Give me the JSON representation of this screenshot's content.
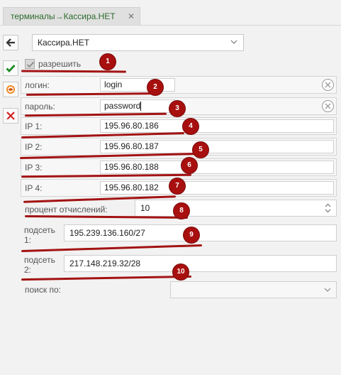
{
  "tab": {
    "title": "терминалы→Кассира.НЕТ",
    "close": "✕"
  },
  "toolbar": {
    "back_icon": "arrow-left-icon",
    "save_icon": "check-icon",
    "cancel_icon": "cancel-circle-icon",
    "delete_icon": "red-x-icon"
  },
  "select": {
    "value": "Кассира.НЕТ"
  },
  "enable": {
    "label": "разрешить",
    "checked": true
  },
  "login": {
    "label": "логин:",
    "value": "login"
  },
  "password": {
    "label": "пароль:",
    "value": "password"
  },
  "ip": [
    {
      "label": "IP 1:",
      "value": "195.96.80.186"
    },
    {
      "label": "IP 2:",
      "value": "195.96.80.187"
    },
    {
      "label": "IP 3:",
      "value": "195.96.80.188"
    },
    {
      "label": "IP 4:",
      "value": "195.96.80.182"
    }
  ],
  "percent": {
    "label": "процент отчислений:",
    "value": "10"
  },
  "subnet1": {
    "label_line1": "подсеть",
    "label_line2": "1:",
    "value": "195.239.136.160/27"
  },
  "subnet2": {
    "label_line1": "подсеть",
    "label_line2": "2:",
    "value": "217.148.219.32/28"
  },
  "search_by": {
    "label": "поиск по:",
    "value": ""
  },
  "annotations": [
    "1",
    "2",
    "3",
    "4",
    "5",
    "6",
    "7",
    "8",
    "9",
    "10"
  ],
  "colors": {
    "annotation": "#a31313",
    "tab_text": "#2d6b2d"
  }
}
